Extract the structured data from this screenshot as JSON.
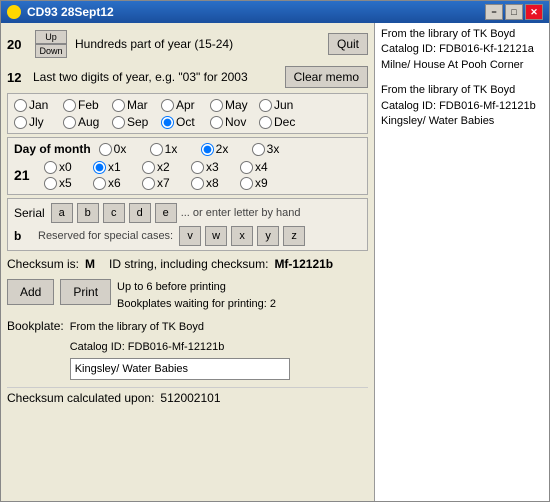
{
  "window": {
    "title": "CD93 28Sept12",
    "title_icon": "cd-icon"
  },
  "title_buttons": {
    "minimize": "−",
    "maximize": "□",
    "close": "✕"
  },
  "row1": {
    "number": "20",
    "up_label": "Up",
    "down_label": "Down",
    "description": "Hundreds part of year (15-24)",
    "quit_label": "Quit"
  },
  "row2": {
    "number": "12",
    "description": "Last two digits of year, e.g. \"03\" for 2003",
    "clear_memo_label": "Clear memo"
  },
  "months": {
    "label": "",
    "options": [
      {
        "id": "jan",
        "label": "Jan",
        "checked": true
      },
      {
        "id": "feb",
        "label": "Feb",
        "checked": false
      },
      {
        "id": "mar",
        "label": "Mar",
        "checked": false
      },
      {
        "id": "apr",
        "label": "Apr",
        "checked": false
      },
      {
        "id": "may",
        "label": "May",
        "checked": false
      },
      {
        "id": "jun",
        "label": "Jun",
        "checked": false
      },
      {
        "id": "jly",
        "label": "Jly",
        "checked": false
      },
      {
        "id": "aug",
        "label": "Aug",
        "checked": false
      },
      {
        "id": "sep",
        "label": "Sep",
        "checked": false
      },
      {
        "id": "oct",
        "label": "Oct",
        "checked": true
      },
      {
        "id": "nov",
        "label": "Nov",
        "checked": false
      },
      {
        "id": "dec",
        "label": "Dec",
        "checked": false
      }
    ]
  },
  "day_section": {
    "label": "Day of month",
    "multipliers": [
      {
        "id": "0x",
        "label": "0x",
        "checked": false
      },
      {
        "id": "1x",
        "label": "1x",
        "checked": false
      },
      {
        "id": "2x",
        "label": "2x",
        "checked": true
      },
      {
        "id": "3x",
        "label": "3x",
        "checked": false
      }
    ],
    "number": "21",
    "x_options": [
      [
        {
          "id": "x0",
          "label": "x0",
          "checked": false
        },
        {
          "id": "x1",
          "label": "x1",
          "checked": true
        },
        {
          "id": "x2",
          "label": "x2",
          "checked": false
        },
        {
          "id": "x3",
          "label": "x3",
          "checked": false
        },
        {
          "id": "x4",
          "label": "x4",
          "checked": false
        }
      ],
      [
        {
          "id": "x5",
          "label": "x5",
          "checked": false
        },
        {
          "id": "x6",
          "label": "x6",
          "checked": false
        },
        {
          "id": "x7",
          "label": "x7",
          "checked": false
        },
        {
          "id": "x8",
          "label": "x8",
          "checked": false
        },
        {
          "id": "x9",
          "label": "x9",
          "checked": false
        }
      ]
    ]
  },
  "serial": {
    "label": "Serial",
    "value": "b",
    "letters": [
      "a",
      "b",
      "c",
      "d",
      "e"
    ],
    "or_text": "... or enter letter by hand",
    "reserved_label": "Reserved for special cases:",
    "special_letters": [
      "v",
      "w",
      "x",
      "y",
      "z"
    ]
  },
  "checksum": {
    "label": "Checksum is:",
    "value": "M",
    "id_label": "ID string, including checksum:",
    "id_value": "Mf-12121b"
  },
  "actions": {
    "add_label": "Add",
    "print_label": "Print",
    "up_to_6": "Up to 6 before printing",
    "waiting": "Bookplates waiting for printing: 2"
  },
  "bookplate": {
    "label": "Bookplate:",
    "text_line1": "From the library of TK Boyd",
    "text_line2": "Catalog ID: FDB016-Mf-12121b",
    "input_value": "Kingsley/ Water Babies"
  },
  "checksum_bottom": {
    "label": "Checksum calculated upon:",
    "value": "512002101"
  },
  "right_panel": {
    "entry1": "From the library of TK Boyd\nCatalog ID: FDB016-Kf-12121a\nMilne/ House At Pooh Corner",
    "entry2": "From the library of TK Boyd\nCatalog ID: FDB016-Mf-12121b\nKingsley/ Water Babies"
  }
}
